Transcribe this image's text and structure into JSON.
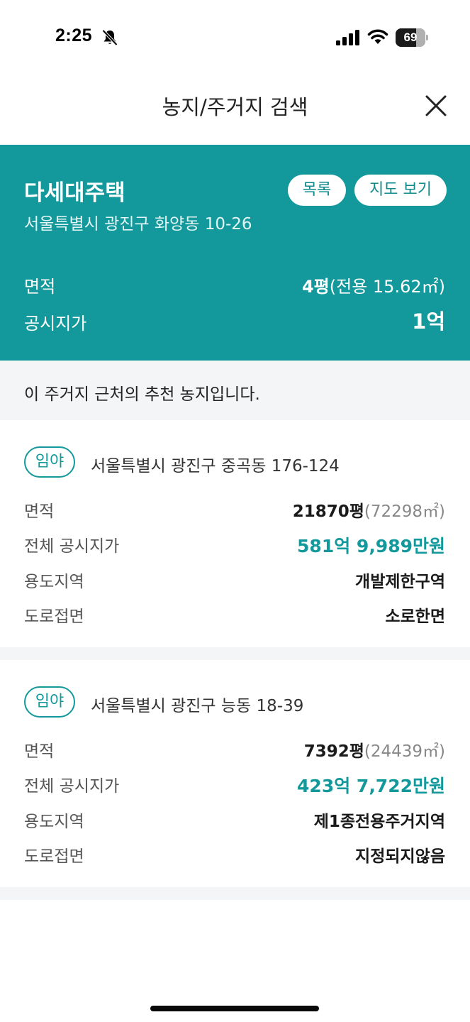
{
  "status_bar": {
    "time": "2:25",
    "battery_level": "69",
    "battery_percent": 69
  },
  "header": {
    "title": "농지/주거지 검색",
    "close_icon": "close-icon"
  },
  "property": {
    "type": "다세대주택",
    "address": "서울특별시 광진구 화양동 10-26",
    "list_button": "목록",
    "map_button": "지도 보기",
    "area_label": "면적",
    "area_value_main": "4평",
    "area_value_sub": "(전용 15.62㎡)",
    "price_label": "공시지가",
    "price_value": "1억"
  },
  "notice": {
    "text": "이 주거지 근처의 추천 농지입니다."
  },
  "recommendations": [
    {
      "badge": "임야",
      "address": "서울특별시 광진구 중곡동 176-124",
      "area_label": "면적",
      "area_main": "21870평",
      "area_sub": "(72298㎡)",
      "price_label": "전체 공시지가",
      "price_value": "581억 9,989만원",
      "zone_label": "용도지역",
      "zone_value": "개발제한구역",
      "road_label": "도로접면",
      "road_value": "소로한면"
    },
    {
      "badge": "임야",
      "address": "서울특별시 광진구 능동 18-39",
      "area_label": "면적",
      "area_main": "7392평",
      "area_sub": "(24439㎡)",
      "price_label": "전체 공시지가",
      "price_value": "423억 7,722만원",
      "zone_label": "용도지역",
      "zone_value": "제1종전용주거지역",
      "road_label": "도로접면",
      "road_value": "지정되지않음"
    }
  ],
  "colors": {
    "accent": "#13999b",
    "background_gray": "#f4f5f7"
  }
}
